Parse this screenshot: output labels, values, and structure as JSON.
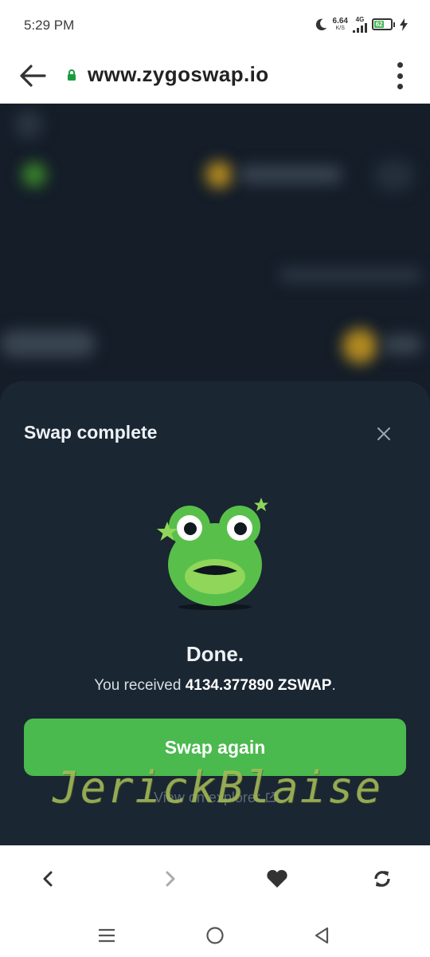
{
  "status_bar": {
    "time": "5:29 PM",
    "net_speed": "6.64",
    "net_speed_unit": "K/S",
    "network": "4G",
    "battery": "62"
  },
  "browser": {
    "url": "www.zygoswap.io"
  },
  "modal": {
    "title": "Swap complete",
    "done_text": "Done.",
    "received_prefix": "You received",
    "received_amount": "4134.377890 ZSWAP",
    "received_suffix": ".",
    "swap_again_label": "Swap again",
    "explorer_label": "View on explorer"
  },
  "watermark": "JerickBlaise",
  "colors": {
    "accent": "#4ab94e",
    "modal_bg": "#1a2632",
    "app_bg": "#141d28"
  },
  "icons": {
    "back": "arrow-left-icon",
    "lock": "lock-icon",
    "menu": "more-vert-icon",
    "close": "close-icon",
    "frog": "frog-mascot-icon",
    "external": "external-link-icon",
    "prev": "chevron-left-icon",
    "next": "chevron-right-icon",
    "favorite": "heart-icon",
    "refresh": "refresh-icon",
    "recents": "menu-lines-icon",
    "home": "home-circle-icon",
    "nav_back": "triangle-back-icon"
  }
}
